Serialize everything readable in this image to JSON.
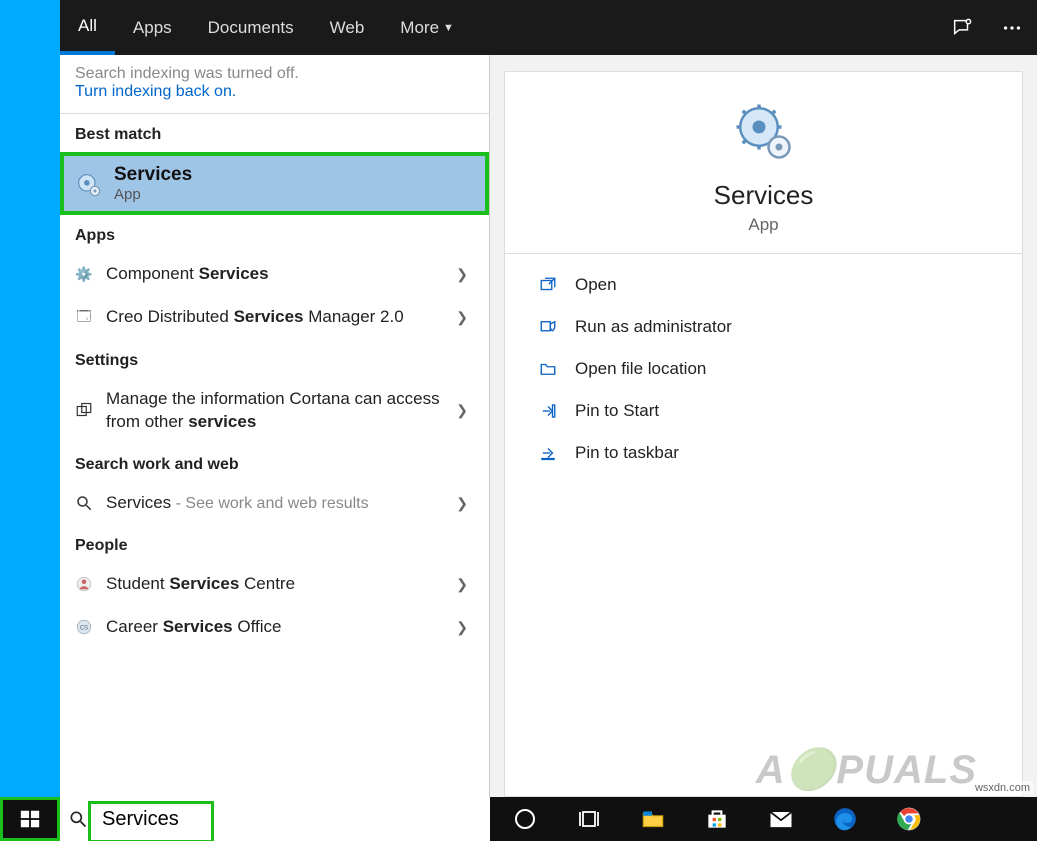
{
  "tabs": {
    "all": "All",
    "apps": "Apps",
    "documents": "Documents",
    "web": "Web",
    "more": "More"
  },
  "indexing": {
    "message": "Search indexing was turned off.",
    "link": "Turn indexing back on."
  },
  "sections": {
    "best_match": "Best match",
    "apps": "Apps",
    "settings": "Settings",
    "work_web": "Search work and web",
    "people": "People"
  },
  "best_match": {
    "title": "Services",
    "subtitle": "App"
  },
  "apps_list": {
    "component_pre": "Component ",
    "component_bold": "Services",
    "creo_pre": "Creo Distributed ",
    "creo_bold": "Services",
    "creo_post": " Manager 2.0"
  },
  "settings_list": {
    "cortana_pre": "Manage the information Cortana can access from other ",
    "cortana_bold": "services"
  },
  "workweb": {
    "term": "Services",
    "suffix": " - See work and web results"
  },
  "people": {
    "student_pre": "Student ",
    "student_bold": "Services",
    "student_post": " Centre",
    "career_pre": "Career ",
    "career_bold": "Services",
    "career_post": " Office"
  },
  "hero": {
    "title": "Services",
    "subtitle": "App"
  },
  "actions": {
    "open": "Open",
    "run_admin": "Run as administrator",
    "open_loc": "Open file location",
    "pin_start": "Pin to Start",
    "pin_taskbar": "Pin to taskbar"
  },
  "search": {
    "value": "Services"
  },
  "watermark": "wsxdn.com"
}
